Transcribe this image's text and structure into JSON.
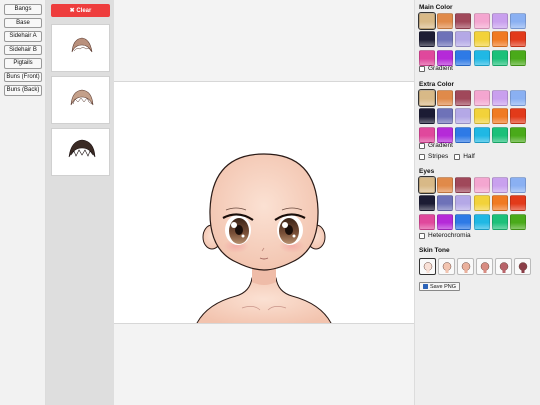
{
  "categories": [
    "Bangs",
    "Base",
    "Sidehair A",
    "Sidehair B",
    "Pigtails",
    "Buns (Front)",
    "Buns (Back)"
  ],
  "clear_label": "✖ Clear",
  "main_color": {
    "title": "Main Color",
    "gradient_label": "Gradient",
    "swatches": [
      "#d8b987",
      "#e08a4a",
      "#a0485a",
      "#f4a6d0",
      "#c9a0ee",
      "#8ab0f2",
      "#1c1c34",
      "#6e72b8",
      "#b4a8e6",
      "#f2d23a",
      "#f07a22",
      "#e23a1a",
      "#e0489c",
      "#b52ad8",
      "#2e7ae6",
      "#20b8e4",
      "#1cc07a",
      "#4aaa1a"
    ]
  },
  "extra_color": {
    "title": "Extra Color",
    "gradient_label": "Gradient",
    "stripes_label": "Stripes",
    "half_label": "Half",
    "swatches": [
      "#d8b987",
      "#e08a4a",
      "#a0485a",
      "#f4a6d0",
      "#c9a0ee",
      "#8ab0f2",
      "#1c1c34",
      "#6e72b8",
      "#b4a8e6",
      "#f2d23a",
      "#f07a22",
      "#e23a1a",
      "#e0489c",
      "#b52ad8",
      "#2e7ae6",
      "#20b8e4",
      "#1cc07a",
      "#4aaa1a"
    ]
  },
  "eyes": {
    "title": "Eyes",
    "heterochromia_label": "Heterochromia",
    "swatches": [
      "#d8b987",
      "#e08a4a",
      "#a0485a",
      "#f4a6d0",
      "#c9a0ee",
      "#8ab0f2",
      "#1c1c34",
      "#6e72b8",
      "#b4a8e6",
      "#f2d23a",
      "#f07a22",
      "#e23a1a",
      "#e0489c",
      "#b52ad8",
      "#2e7ae6",
      "#20b8e4",
      "#1cc07a",
      "#4aaa1a"
    ]
  },
  "skin_tone": {
    "title": "Skin Tone",
    "tones": [
      "#f8e0d6",
      "#f2c4b0",
      "#eab09c",
      "#d88c82",
      "#b8646a",
      "#8a3e48"
    ]
  },
  "save_label": "Save PNG",
  "accent": "#ee3d3d"
}
